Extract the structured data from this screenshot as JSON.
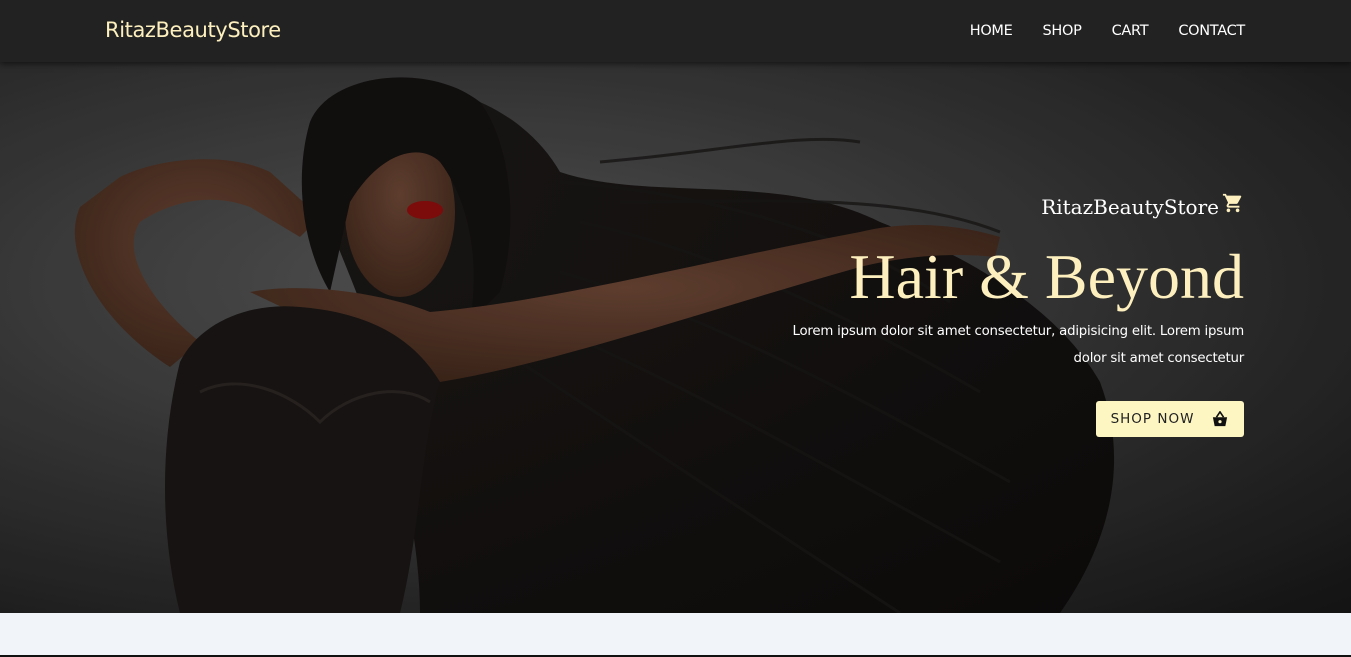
{
  "navbar": {
    "brand": "RitazBeautyStore",
    "links": [
      "HOME",
      "SHOP",
      "CART",
      "CONTACT"
    ]
  },
  "hero": {
    "store_name": "RitazBeautyStore",
    "title": "Hair & Beyond",
    "text": "Lorem ipsum dolor sit amet consectetur, adipisicing elit. Lorem ipsum dolor sit amet consectetur",
    "button_label": "SHOP NOW",
    "image_description_icon": "cart-icon"
  },
  "colors": {
    "navbar_bg": "#222222",
    "accent": "#fdf0be",
    "button_bg": "#fdf6c3",
    "page_bg": "#f1f4f9"
  }
}
